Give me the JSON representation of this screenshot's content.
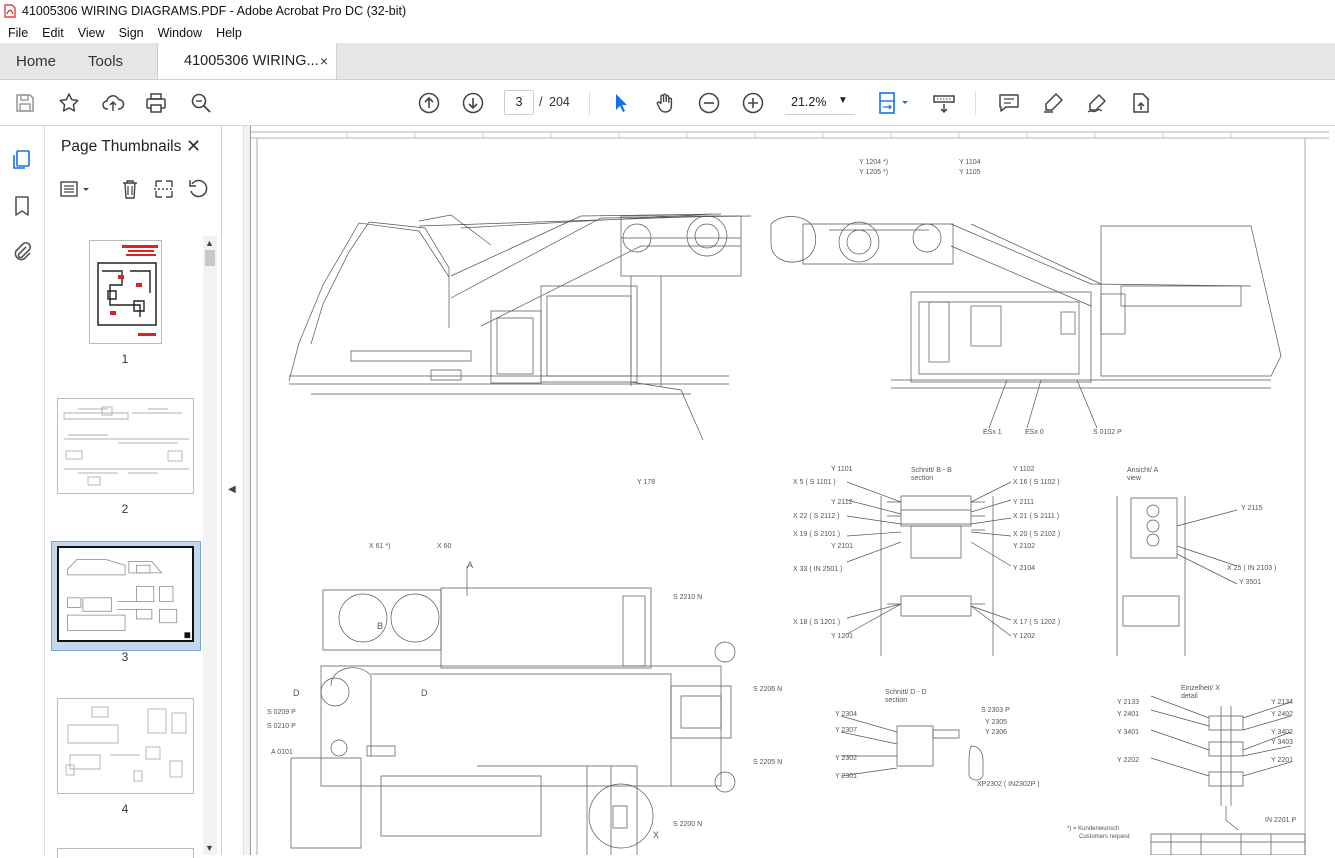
{
  "window": {
    "title": "41005306 WIRING DIAGRAMS.PDF - Adobe Acrobat Pro DC (32-bit)"
  },
  "menu": [
    "File",
    "Edit",
    "View",
    "Sign",
    "Window",
    "Help"
  ],
  "tabs": {
    "home": "Home",
    "tools": "Tools",
    "document": "41005306 WIRING...",
    "close": "×"
  },
  "toolbar": {
    "page_current": "3",
    "page_separator": "/",
    "page_total": "204",
    "zoom": "21.2%",
    "icons": [
      "save-icon",
      "star-icon",
      "upload-icon",
      "print-icon",
      "zoom-search-icon",
      "page-up-icon",
      "page-down-icon",
      "select-arrow-icon",
      "hand-icon",
      "zoom-out-icon",
      "zoom-in-icon",
      "zoom-select-icon",
      "fit-page-icon",
      "scroll-mode-icon",
      "comment-icon",
      "highlight-icon",
      "sign-icon",
      "share-icon"
    ]
  },
  "panel": {
    "title": "Page Thumbnails",
    "close": "✕",
    "thumbnails": [
      {
        "label": "1"
      },
      {
        "label": "2"
      },
      {
        "label": "3",
        "selected": true
      },
      {
        "label": "4"
      }
    ]
  },
  "drawing": {
    "labels": [
      "Y 1204 *)",
      "Y 1205 *)",
      "Y 1104",
      "Y 1105",
      "Y 178",
      "ESx 1",
      "ESx 0",
      "S 0102 P",
      "Schnitt/ B - B",
      "section",
      "Ansicht/ A",
      "view",
      "Y 1101",
      "X 5 ( S 1101 )",
      "Y 2112",
      "X 22 ( S 2112 )",
      "X 19 ( S 2101 )",
      "Y 2101",
      "X 33 ( IN 2501 )",
      "Y 1102",
      "X 16 ( S 1102 )",
      "Y 2111",
      "X 21 ( S 2111 )",
      "X 20 ( S 2102 )",
      "Y 2102",
      "Y 2104",
      "X 18 ( S 1201 )",
      "Y 1201",
      "X 17 ( S 1202 )",
      "Y 1202",
      "Y 2115",
      "X 25 ( IN 2103 )",
      "Y 3501",
      "X 61 *)",
      "X 60",
      "A",
      "B",
      "D",
      "D",
      "S 2210 N",
      "S 2206 N",
      "S 2205 N",
      "S 2200 N",
      "S 0209 P",
      "S 0210 P",
      "A 0101",
      "X",
      "Schnitt/ D - D",
      "section",
      "Y 2304",
      "Y 2307",
      "Y 2302",
      "Y 2301",
      "S 2303 P",
      "Y 2305",
      "Y 2306",
      "XP2302 ( IN2302P )",
      "Einzelheit/ X",
      "detail",
      "Y 2133",
      "Y 2401",
      "Y 3401",
      "Y 2202",
      "Y 2134",
      "Y 2402",
      "Y 3402",
      "Y 3403",
      "Y 2201",
      "IN 2201 P",
      "*) = Kundenwunsch",
      "Customers request"
    ]
  }
}
